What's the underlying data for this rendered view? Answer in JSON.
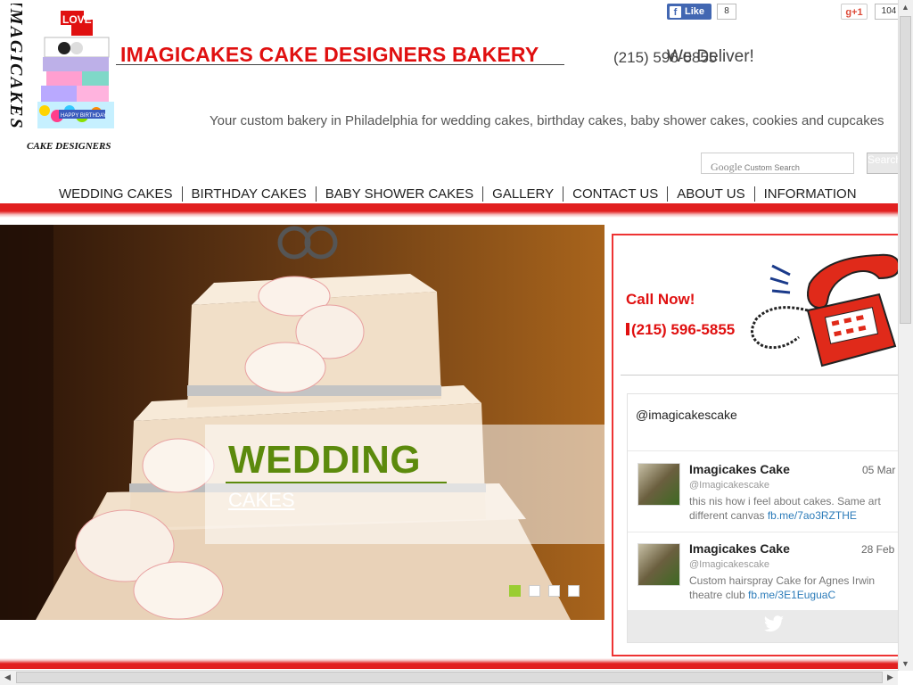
{
  "header": {
    "logo_vertical_text": "IMAGICAKES",
    "logo_bottom_text": "CAKE DESIGNERS",
    "logo_topper_text": "LOVE",
    "logo_cake_text": "HAPPY BIRTHDAY",
    "title": "IMAGICAKES CAKE DESIGNERS BAKERY",
    "phone": "(215) 596-5855",
    "deliver": "We Deliver!",
    "tagline": "Your custom bakery in Philadelphia for  wedding cakes, birthday cakes, baby shower cakes, cookies  and cupcakes"
  },
  "social": {
    "fb_label": "Like",
    "fb_icon": "f",
    "fb_count": "8",
    "gplus_label": "+1",
    "gplus_icon": "g",
    "gplus_count": "104"
  },
  "search": {
    "brand": "Google",
    "watermark": "Custom Search",
    "button_label": "Search"
  },
  "nav": {
    "items": [
      "WEDDING CAKES",
      "BIRTHDAY CAKES",
      "BABY SHOWER CAKES",
      "GALLERY",
      "CONTACT US",
      "ABOUT US",
      "INFORMATION"
    ]
  },
  "slider": {
    "title": "WEDDING",
    "subtitle": "CAKES",
    "active_dot": 0,
    "dot_count": 4,
    "active_color": "#9acd32"
  },
  "sidebar": {
    "call_now": "Call Now!",
    "phone": "(215) 596-5855"
  },
  "twitter": {
    "handle": "@imagicakescake",
    "tweets": [
      {
        "name": "Imagicakes Cake",
        "user": "@Imagicakescake",
        "date": "05 Mar",
        "text": "this nis how i feel about cakes. Same art different canvas ",
        "link": "fb.me/7ao3RZTHE"
      },
      {
        "name": "Imagicakes Cake",
        "user": "@Imagicakescake",
        "date": "28 Feb",
        "text": "Custom hairspray Cake for Agnes Irwin theatre club ",
        "link": "fb.me/3E1EuguaC"
      }
    ]
  },
  "colors": {
    "brand_red": "#e01010",
    "caption_green": "#5c8a0c"
  }
}
